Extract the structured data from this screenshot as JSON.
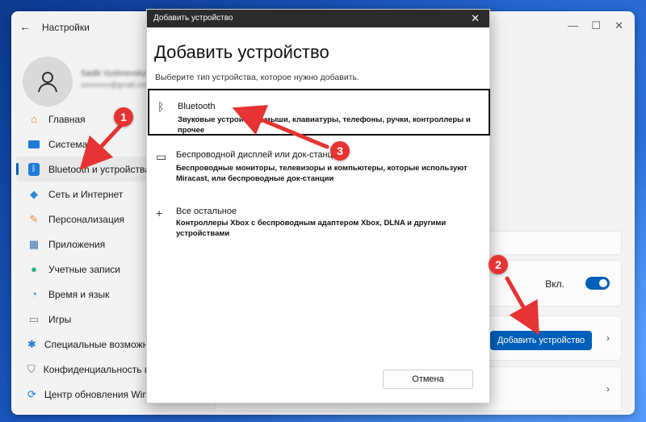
{
  "settings": {
    "title": "Настройки",
    "back_icon": "arrow-left-icon",
    "user": {
      "name": "Sadik Vyshnevskyi",
      "email": "xxxxxxxx@gmail.com"
    },
    "nav": [
      {
        "label": "Главная",
        "icon": "home-icon"
      },
      {
        "label": "Система",
        "icon": "display-icon"
      },
      {
        "label": "Bluetooth и устройства",
        "icon": "bluetooth-icon",
        "active": true
      },
      {
        "label": "Сеть и Интернет",
        "icon": "wifi-icon"
      },
      {
        "label": "Персонализация",
        "icon": "brush-icon"
      },
      {
        "label": "Приложения",
        "icon": "apps-icon"
      },
      {
        "label": "Учетные записи",
        "icon": "user-icon"
      },
      {
        "label": "Время и язык",
        "icon": "globe-clock-icon"
      },
      {
        "label": "Игры",
        "icon": "gamepad-icon"
      },
      {
        "label": "Специальные возможности",
        "icon": "accessibility-icon"
      },
      {
        "label": "Конфиденциальность и защита",
        "icon": "shield-icon"
      },
      {
        "label": "Центр обновления Windows",
        "icon": "update-icon"
      }
    ],
    "toggle_label": "Вкл.",
    "add_device_button": "Добавить устройство"
  },
  "dialog": {
    "window_title": "Добавить устройство",
    "heading": "Добавить устройство",
    "subtitle": "Выберите тип устройства, которое нужно добавить.",
    "options": [
      {
        "title": "Bluetooth",
        "desc": "Звуковые устройства, мыши, клавиатуры, телефоны, ручки, контроллеры и прочее",
        "icon": "bluetooth-icon"
      },
      {
        "title": "Беспроводной дисплей или док-станция",
        "desc": "Беспроводные мониторы, телевизоры и компьютеры, которые используют Miracast, или беспроводные док-станции",
        "icon": "monitor-icon"
      },
      {
        "title": "Все остальное",
        "desc": "Контроллеры Xbox с беспроводным адаптером Xbox, DLNA и другими устройствами",
        "icon": "plus-icon"
      }
    ],
    "cancel_button": "Отмена"
  },
  "annotations": {
    "step1": "1",
    "step2": "2",
    "step3": "3",
    "color": "#e63333"
  }
}
